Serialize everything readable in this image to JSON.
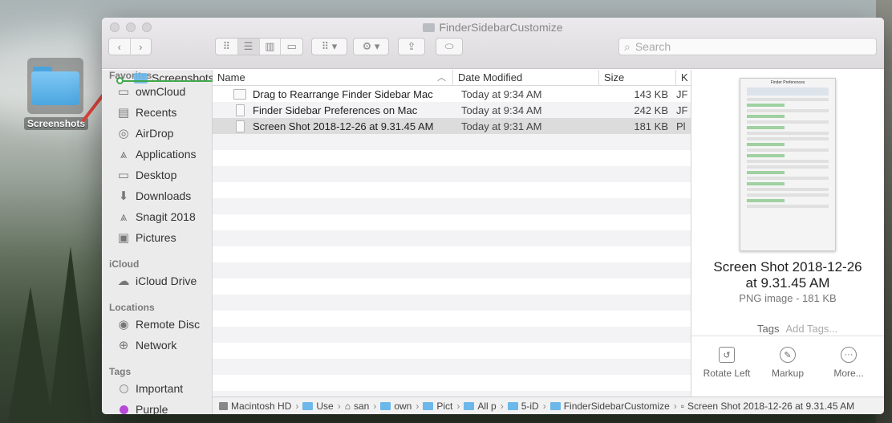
{
  "desktop": {
    "folder_label": "Screenshots"
  },
  "window": {
    "title": "FinderSidebarCustomize",
    "search_placeholder": "Search"
  },
  "sidebar": {
    "drag_ghost_label": "Screenshots",
    "sections": [
      {
        "header": "Favorites",
        "items": [
          {
            "label": "ownCloud",
            "icon": "folder-icon"
          },
          {
            "label": "Recents",
            "icon": "clock-icon"
          },
          {
            "label": "AirDrop",
            "icon": "airdrop-icon"
          },
          {
            "label": "Applications",
            "icon": "applications-icon"
          },
          {
            "label": "Desktop",
            "icon": "desktop-icon"
          },
          {
            "label": "Downloads",
            "icon": "download-icon"
          },
          {
            "label": "Snagit 2018",
            "icon": "applications-icon"
          },
          {
            "label": "Pictures",
            "icon": "camera-icon"
          }
        ]
      },
      {
        "header": "iCloud",
        "items": [
          {
            "label": "iCloud Drive",
            "icon": "cloud-icon"
          }
        ]
      },
      {
        "header": "Locations",
        "items": [
          {
            "label": "Remote Disc",
            "icon": "disc-icon"
          },
          {
            "label": "Network",
            "icon": "globe-icon"
          }
        ]
      },
      {
        "header": "Tags",
        "items": [
          {
            "label": "Important",
            "icon": "tag-gray-icon"
          },
          {
            "label": "Purple",
            "icon": "tag-purple-icon"
          }
        ]
      }
    ]
  },
  "columns": {
    "name": "Name",
    "date": "Date Modified",
    "size": "Size",
    "kind": "K"
  },
  "files": [
    {
      "name": "Drag to Rearrange Finder Sidebar Mac",
      "date": "Today at 9:34 AM",
      "size": "143 KB",
      "kind": "JF",
      "selected": false
    },
    {
      "name": "Finder Sidebar Preferences on Mac",
      "date": "Today at 9:34 AM",
      "size": "242 KB",
      "kind": "JF",
      "selected": false
    },
    {
      "name": "Screen Shot 2018-12-26 at 9.31.45 AM",
      "date": "Today at 9:31 AM",
      "size": "181 KB",
      "kind": "Pl",
      "selected": true
    }
  ],
  "preview": {
    "thumb_title": "Finder Preferences",
    "name": "Screen Shot 2018-12-26 at 9.31.45 AM",
    "kind": "PNG image - 181 KB",
    "tags_label": "Tags",
    "tags_placeholder": "Add Tags...",
    "actions": [
      {
        "label": "Rotate Left",
        "icon": "rotate-left-icon"
      },
      {
        "label": "Markup",
        "icon": "markup-icon"
      },
      {
        "label": "More...",
        "icon": "more-icon"
      }
    ]
  },
  "pathbar": [
    {
      "label": "Macintosh HD",
      "icon": "disk-icon"
    },
    {
      "label": "Use",
      "icon": "folder-icon"
    },
    {
      "label": "san",
      "icon": "home-icon"
    },
    {
      "label": "own",
      "icon": "folder-icon"
    },
    {
      "label": "Pict",
      "icon": "folder-icon"
    },
    {
      "label": "All p",
      "icon": "folder-icon"
    },
    {
      "label": "5-iD",
      "icon": "folder-icon"
    },
    {
      "label": "FinderSidebarCustomize",
      "icon": "folder-icon"
    },
    {
      "label": "Screen Shot 2018-12-26 at 9.31.45 AM",
      "icon": "image-file-icon"
    }
  ],
  "colors": {
    "drop_indicator": "#3fa84b",
    "arrow": "#e3473a",
    "folder": "#6cb8ea",
    "tag_purple": "#b74ad8"
  }
}
